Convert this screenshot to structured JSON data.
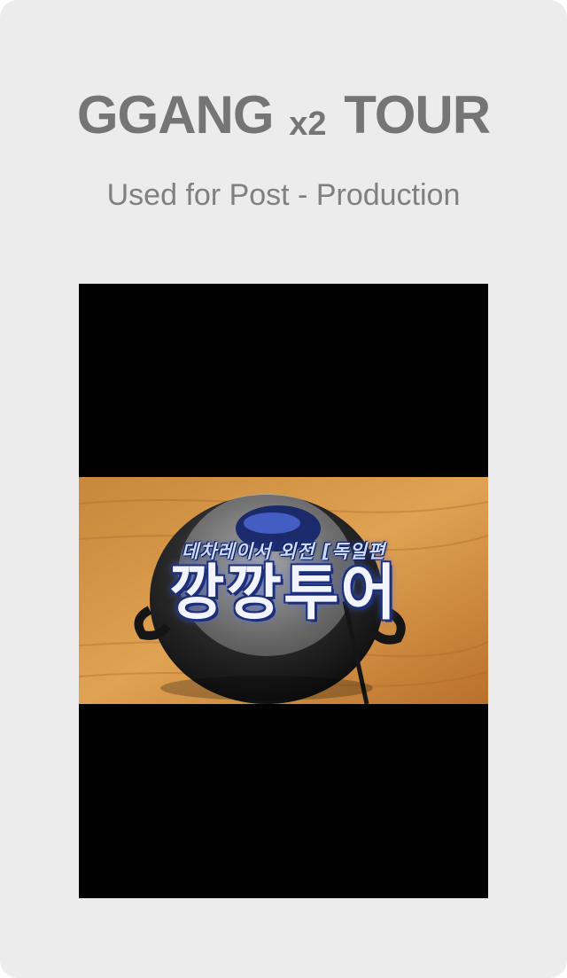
{
  "card": {
    "title_main": "GGANG",
    "title_multiplier": "x2",
    "title_end": "TOUR",
    "subtitle": "Used for Post - Production"
  },
  "video": {
    "caption_top": "데차레이서 외전 [독일편",
    "caption_main": "깡깡투어"
  },
  "colors": {
    "card_background": "#ececec",
    "title_text": "#757575",
    "subtitle_text": "#808080",
    "letterbox": "#000000"
  }
}
